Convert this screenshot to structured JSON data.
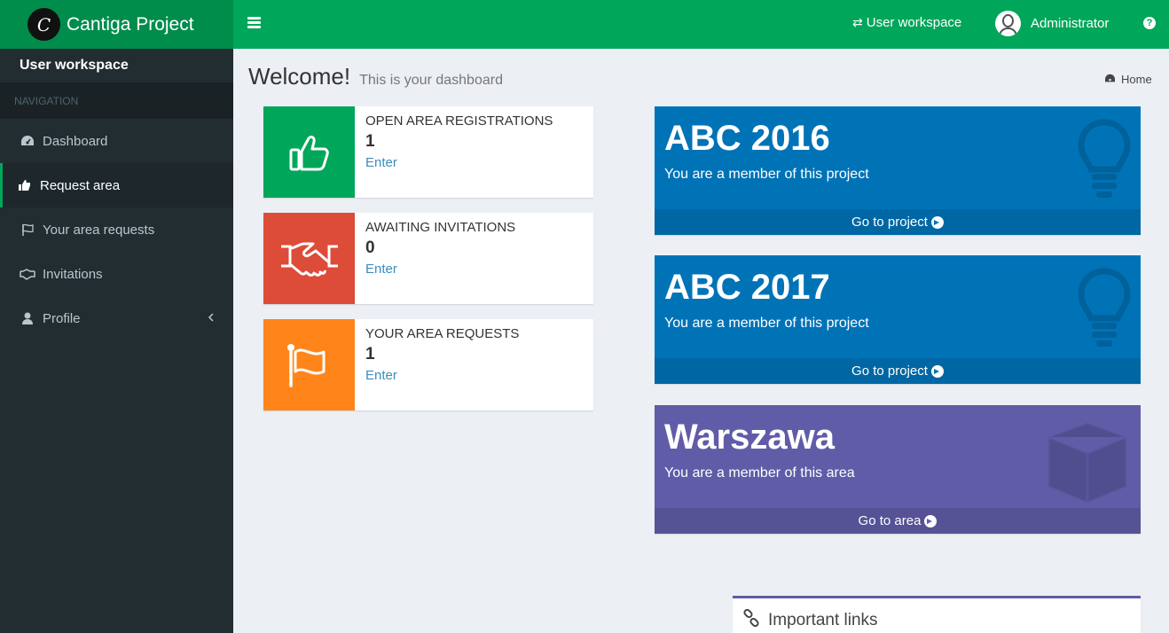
{
  "app": {
    "title": "Cantiga Project",
    "logo_glyph": "C"
  },
  "topbar": {
    "workspace_label": "User workspace",
    "user_name": "Administrator"
  },
  "sidebar": {
    "workspace_title": "User workspace",
    "nav_header": "NAVIGATION",
    "items": [
      {
        "label": "Dashboard",
        "icon": "dashboard-icon"
      },
      {
        "label": "Request area",
        "icon": "thumbs-up-icon",
        "active": true
      },
      {
        "label": "Your area requests",
        "icon": "flag-icon"
      },
      {
        "label": "Invitations",
        "icon": "handshake-icon"
      },
      {
        "label": "Profile",
        "icon": "user-icon"
      }
    ]
  },
  "page": {
    "title": "Welcome!",
    "subtitle": "This is your dashboard",
    "breadcrumb_home": "Home"
  },
  "info_boxes": [
    {
      "label": "OPEN AREA REGISTRATIONS",
      "count": "1",
      "link": "Enter",
      "color": "#00a65a",
      "icon": "thumbs-up-icon"
    },
    {
      "label": "AWAITING INVITATIONS",
      "count": "0",
      "link": "Enter",
      "color": "#dd4b39",
      "icon": "handshake-icon"
    },
    {
      "label": "YOUR AREA REQUESTS",
      "count": "1",
      "link": "Enter",
      "color": "#ff851b",
      "icon": "flag-icon"
    }
  ],
  "project_boxes": [
    {
      "title": "ABC 2016",
      "text": "You are a member of this project",
      "link": "Go to project",
      "color": "#0073b7",
      "icon": "lightbulb-icon"
    },
    {
      "title": "ABC 2017",
      "text": "You are a member of this project",
      "link": "Go to project",
      "color": "#0073b7",
      "icon": "lightbulb-icon"
    },
    {
      "title": "Warszawa",
      "text": "You are a member of this area",
      "link": "Go to area",
      "color": "#605ca8",
      "icon": "cube-icon"
    }
  ],
  "links_box": {
    "title": "Important links"
  }
}
